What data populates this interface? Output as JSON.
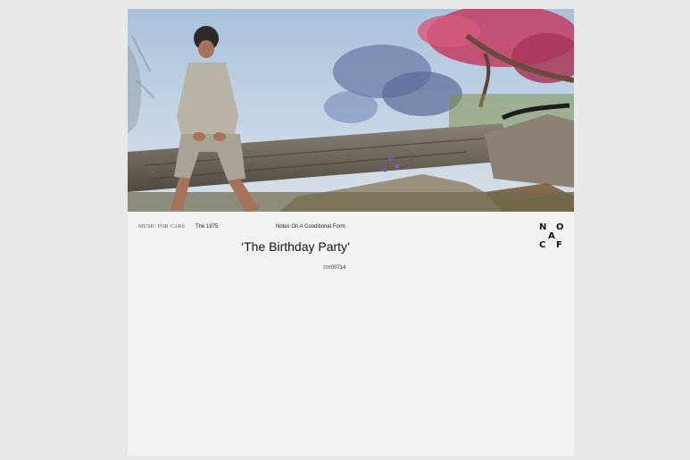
{
  "record_label": "MUSIC FOR CARS",
  "artist": "The 1975",
  "album": "Notes On A Conditional Form",
  "song_title": "‘The Birthday Party’",
  "catalog": {
    "prefix": "DH",
    "number": "00714"
  },
  "logo": {
    "letters": [
      "N",
      "O",
      "A",
      "C",
      "F"
    ]
  },
  "colors": {
    "page_background": "#e8e8e8",
    "sleeve": "#f2f2f2",
    "text": "#111111",
    "sky": "#b9cde2",
    "blossom": "#c2456a"
  },
  "artwork": {
    "icon": "photo-artwork"
  }
}
